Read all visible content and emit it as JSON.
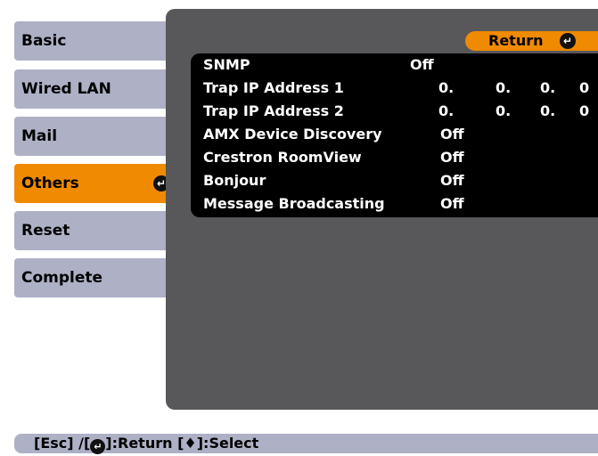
{
  "menu": {
    "items": [
      {
        "label": "Basic"
      },
      {
        "label": "Wired LAN"
      },
      {
        "label": "Mail"
      },
      {
        "label": "Others",
        "selected": true
      },
      {
        "label": "Reset"
      },
      {
        "label": "Complete"
      }
    ],
    "selected_icon": "↵"
  },
  "return_button": {
    "label": "Return",
    "icon": "↵"
  },
  "settings": {
    "snmp": {
      "label": "SNMP",
      "value": "Off"
    },
    "trap1": {
      "label": "Trap IP Address 1",
      "octets": [
        "0.",
        "0.",
        "0.",
        "0"
      ]
    },
    "trap2": {
      "label": "Trap IP Address 2",
      "octets": [
        "0.",
        "0.",
        "0.",
        "0"
      ]
    },
    "amx": {
      "label": "AMX Device Discovery",
      "value": "Off"
    },
    "crestron": {
      "label": "Crestron RoomView",
      "value": "Off"
    },
    "bonjour": {
      "label": "Bonjour",
      "value": "Off"
    },
    "message": {
      "label": "Message Broadcasting",
      "value": "Off"
    }
  },
  "status_bar": {
    "part1": "[Esc] /[",
    "icon": "↵",
    "part2": "]:Return  [♦]:Select"
  },
  "colors": {
    "menu_bg": "#aeb0c6",
    "selected": "#f08a00",
    "panel": "#58585a",
    "list_bg": "#000000"
  }
}
